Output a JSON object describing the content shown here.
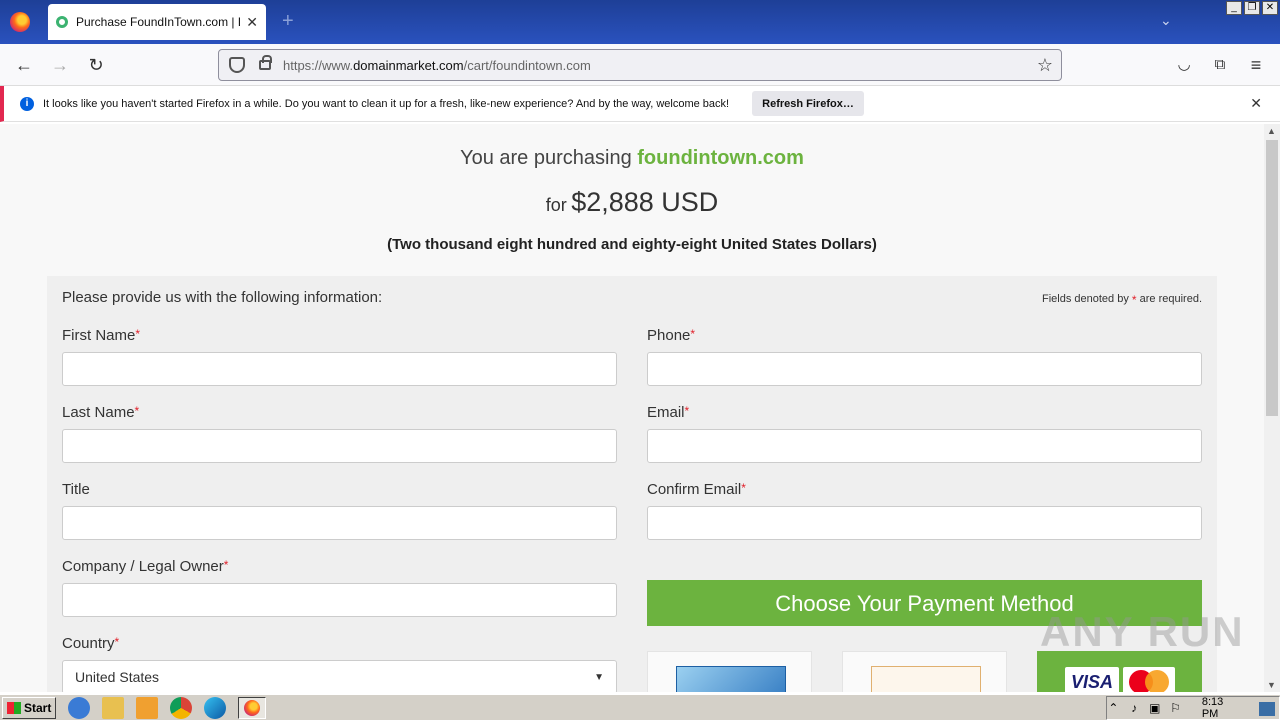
{
  "browser": {
    "tab_title": "Purchase FoundInTown.com | Dom",
    "url_prefix": "https://www.",
    "url_domain": "domainmarket.com",
    "url_path": "/cart/foundintown.com"
  },
  "notification": {
    "text": "It looks like you haven't started Firefox in a while. Do you want to clean it up for a fresh, like-new experience? And by the way, welcome back!",
    "button_label": "Refresh Firefox…"
  },
  "purchase": {
    "prefix": "You are purchasing",
    "domain": "foundintown.com",
    "for_label": "for",
    "amount": "$2,888 USD",
    "amount_words": "(Two thousand eight hundred and eighty-eight United States Dollars)"
  },
  "form": {
    "intro": "Please provide us with the following information:",
    "required_note_prefix": "Fields denoted by",
    "required_mark": "*",
    "required_note_suffix": "are required.",
    "fields": {
      "first_name": "First Name",
      "last_name": "Last Name",
      "title": "Title",
      "company": "Company / Legal Owner",
      "country": "Country",
      "phone": "Phone",
      "email": "Email",
      "confirm_email": "Confirm Email"
    },
    "country_value": "United States",
    "payment_header": "Choose Your Payment Method"
  },
  "payment_icons": [
    "amex-card-icon",
    "paypal-icon",
    "visa-mastercard-icon"
  ],
  "visa_label": "VISA",
  "watermark": "ANY RUN",
  "taskbar": {
    "start_label": "Start",
    "clock": "8:13 PM"
  },
  "colors": {
    "accent_green": "#6cb33f",
    "required_red": "#e0202a",
    "notification_stripe": "#e22850"
  }
}
